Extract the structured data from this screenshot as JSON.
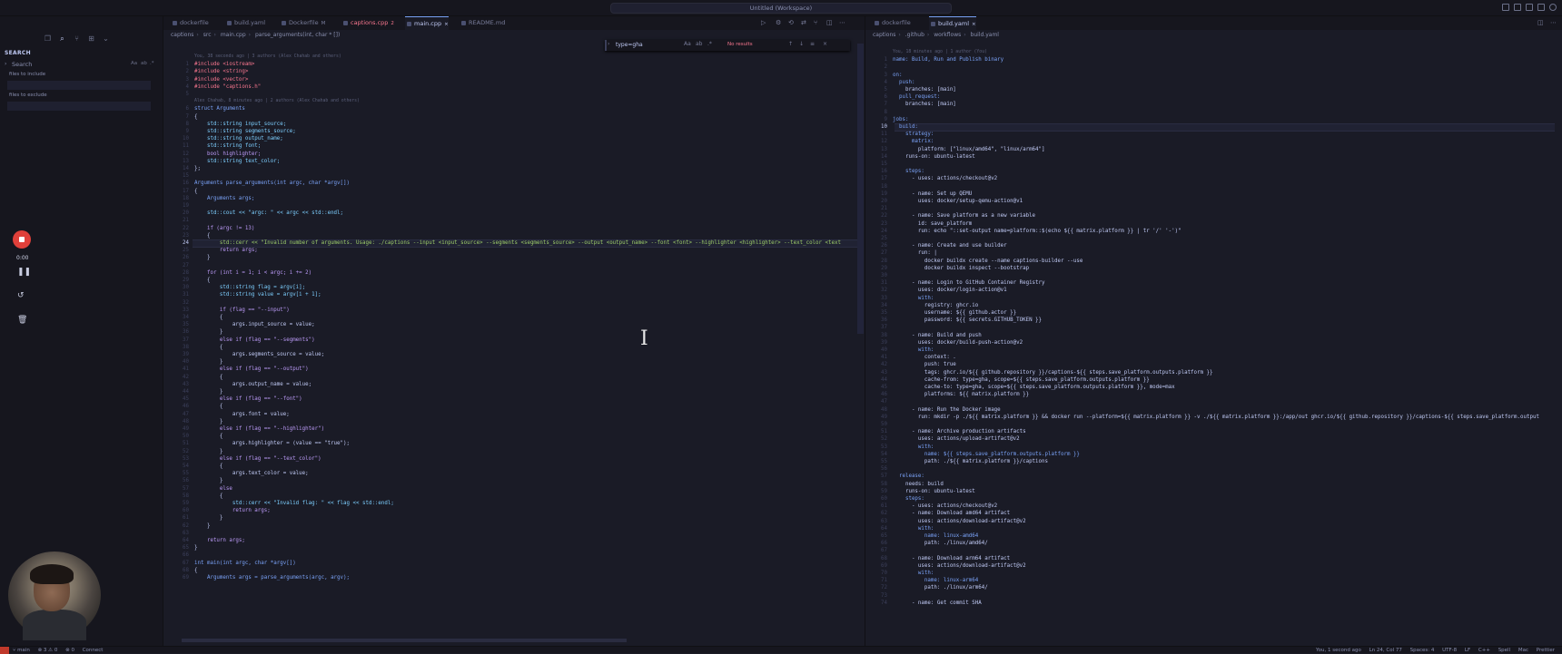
{
  "window": {
    "title": "Untitled (Workspace)"
  },
  "sidebar": {
    "title": "SEARCH",
    "search_label": "Search",
    "search_opts": [
      "Aa",
      "ab",
      ".*"
    ],
    "files_include_label": "files to include",
    "files_exclude_label": "files to exclude"
  },
  "recorder": {
    "time": "0:00"
  },
  "left_editor": {
    "tabs": [
      {
        "label": "dockerfile",
        "suffix": ""
      },
      {
        "label": "build.yaml",
        "suffix": ""
      },
      {
        "label": "Dockerfile",
        "suffix": "M"
      },
      {
        "label": "captions.cpp",
        "suffix": "2"
      },
      {
        "label": "main.cpp",
        "suffix": "×"
      },
      {
        "label": "README.md",
        "suffix": ""
      }
    ],
    "breadcrumb": [
      "captions",
      "src",
      "main.cpp",
      "parse_arguments(int, char * [])"
    ],
    "find": {
      "query": "type=gha",
      "result": "No results"
    },
    "blame": [
      {
        "before_line": 1,
        "text": "You, 38 seconds ago | 3 authors (Alex Chahab and others)"
      },
      {
        "before_line": 6,
        "text": "Alex Chahab, 8 minutes ago | 2 authors (Alex Chahab and others)"
      }
    ],
    "current_line": 24,
    "lines": [
      "#include <iostream>",
      "#include <string>",
      "#include <vector>",
      "#include \"captions.h\"",
      "",
      "struct Arguments",
      "{",
      "    std::string input_source;",
      "    std::string segments_source;",
      "    std::string output_name;",
      "    std::string font;",
      "    bool highlighter;",
      "    std::string text_color;",
      "};",
      "",
      "Arguments parse_arguments(int argc, char *argv[])",
      "{",
      "    Arguments args;",
      "",
      "    std::cout << \"argc: \" << argc << std::endl;",
      "",
      "    if (argc != 13)",
      "    {",
      "        std::cerr << \"Invalid number of arguments. Usage: ./captions --input <input_source> --segments <segments_source> --output <output_name> --font <font> --highlighter <highlighter> --text_color <text",
      "        return args;",
      "    }",
      "",
      "    for (int i = 1; i < argc; i += 2)",
      "    {",
      "        std::string flag = argv[i];",
      "        std::string value = argv[i + 1];",
      "",
      "        if (flag == \"--input\")",
      "        {",
      "            args.input_source = value;",
      "        }",
      "        else if (flag == \"--segments\")",
      "        {",
      "            args.segments_source = value;",
      "        }",
      "        else if (flag == \"--output\")",
      "        {",
      "            args.output_name = value;",
      "        }",
      "        else if (flag == \"--font\")",
      "        {",
      "            args.font = value;",
      "        }",
      "        else if (flag == \"--highlighter\")",
      "        {",
      "            args.highlighter = (value == \"true\");",
      "        }",
      "        else if (flag == \"--text_color\")",
      "        {",
      "            args.text_color = value;",
      "        }",
      "        else",
      "        {",
      "            std::cerr << \"Invalid flag: \" << flag << std::endl;",
      "            return args;",
      "        }",
      "    }",
      "",
      "    return args;",
      "}",
      "",
      "int main(int argc, char *argv[])",
      "{",
      "    Arguments args = parse_arguments(argc, argv);"
    ]
  },
  "right_editor": {
    "tabs": [
      {
        "label": "dockerfile",
        "suffix": ""
      },
      {
        "label": "build.yaml",
        "suffix": "×"
      }
    ],
    "breadcrumb": [
      "captions",
      ".github",
      "workflows",
      "build.yaml"
    ],
    "blame": [
      {
        "before_line": 1,
        "text": "You, 18 minutes ago | 1 author (You)"
      }
    ],
    "current_line": 10,
    "lines": [
      "name: Build, Run and Publish binary",
      "",
      "on:",
      "  push:",
      "    branches: [main]",
      "  pull_request:",
      "    branches: [main]",
      "",
      "jobs:",
      "  build:",
      "    strategy:",
      "      matrix:",
      "        platform: [\"linux/amd64\", \"linux/arm64\"]",
      "    runs-on: ubuntu-latest",
      "",
      "    steps:",
      "      - uses: actions/checkout@v2",
      "",
      "      - name: Set up QEMU",
      "        uses: docker/setup-qemu-action@v1",
      "",
      "      - name: Save platform as a new variable",
      "        id: save_platform",
      "        run: echo \"::set-output name=platform::$(echo ${{ matrix.platform }} | tr '/' '-')\"",
      "",
      "      - name: Create and use builder",
      "        run: |",
      "          docker buildx create --name captions-builder --use",
      "          docker buildx inspect --bootstrap",
      "",
      "      - name: Login to GitHub Container Registry",
      "        uses: docker/login-action@v1",
      "        with:",
      "          registry: ghcr.io",
      "          username: ${{ github.actor }}",
      "          password: ${{ secrets.GITHUB_TOKEN }}",
      "",
      "      - name: Build and push",
      "        uses: docker/build-push-action@v2",
      "        with:",
      "          context: .",
      "          push: true",
      "          tags: ghcr.io/${{ github.repository }}/captions-${{ steps.save_platform.outputs.platform }}",
      "          cache-from: type=gha, scope=${{ steps.save_platform.outputs.platform }}",
      "          cache-to: type=gha, scope=${{ steps.save_platform.outputs.platform }}, mode=max",
      "          platforms: ${{ matrix.platform }}",
      "",
      "      - name: Run the Docker image",
      "        run: mkdir -p ./${{ matrix.platform }} && docker run --platform=${{ matrix.platform }} -v ./${{ matrix.platform }}:/app/out ghcr.io/${{ github.repository }}/captions-${{ steps.save_platform.output",
      "",
      "      - name: Archive production artifacts",
      "        uses: actions/upload-artifact@v2",
      "        with:",
      "          name: ${{ steps.save_platform.outputs.platform }}",
      "          path: ./${{ matrix.platform }}/captions",
      "",
      "  release:",
      "    needs: build",
      "    runs-on: ubuntu-latest",
      "    steps:",
      "      - uses: actions/checkout@v2",
      "      - name: Download amd64 artifact",
      "        uses: actions/download-artifact@v2",
      "        with:",
      "          name: linux-amd64",
      "          path: ./linux/amd64/",
      "",
      "      - name: Download arm64 artifact",
      "        uses: actions/download-artifact@v2",
      "        with:",
      "          name: linux-arm64",
      "          path: ./linux/arm64/",
      "",
      "      - name: Get commit SHA"
    ]
  },
  "statusbar": {
    "branch": "main",
    "problems": "⊗ 3 ⚠ 0",
    "errors_extra": "⊗ 0",
    "connect": "Connect",
    "blame": "You, 1 second ago",
    "position": "Ln 24, Col 77",
    "spaces": "Spaces: 4",
    "encoding": "UTF-8",
    "eol": "LF",
    "language": "C++",
    "extras": [
      "Spell",
      "Mac",
      "Prettier"
    ]
  },
  "colors": {
    "accent": "#7aa2f7",
    "record": "#e0403a",
    "error": "#f7768e"
  }
}
